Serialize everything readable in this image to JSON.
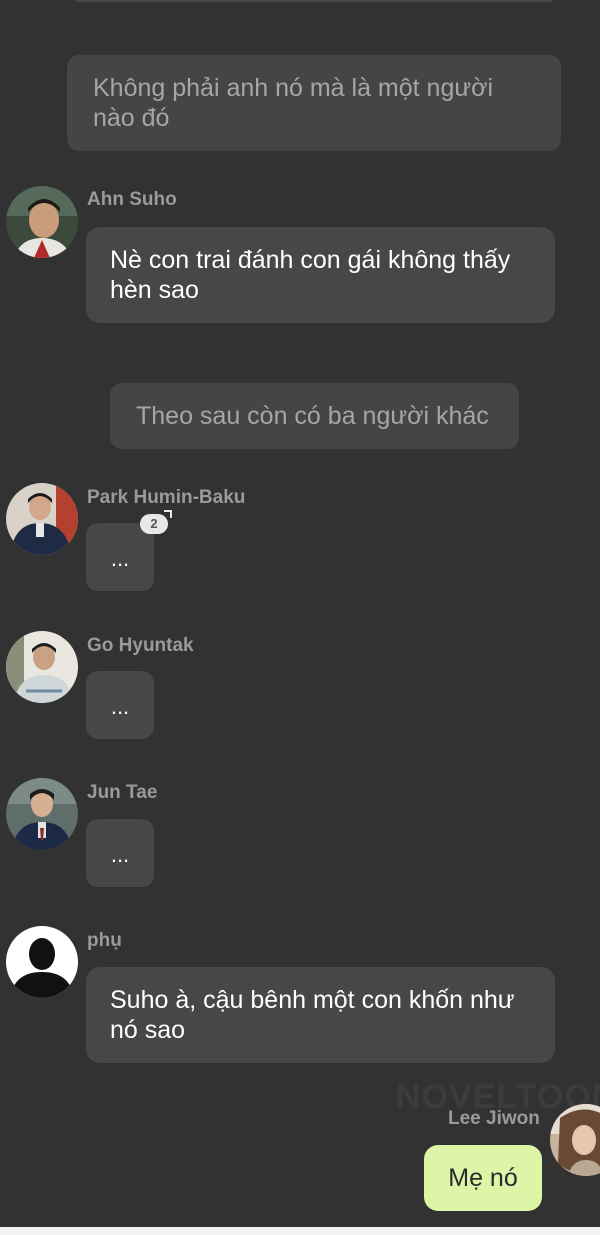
{
  "messages": {
    "narration_1": "Không phải anh nó mà là một người nào đó",
    "suho": {
      "name": "Ahn Suho",
      "text": "Nè con trai đánh con gái không thấy hèn sao"
    },
    "narration_2": "Theo sau còn có ba người khác",
    "baku": {
      "name": "Park Humin-Baku",
      "text": "...",
      "badge": "2"
    },
    "hyuntak": {
      "name": "Go Hyuntak",
      "text": "..."
    },
    "juntae": {
      "name": "Jun Tae",
      "text": "..."
    },
    "phu": {
      "name": "phụ",
      "text": "Suho à, cậu bênh một con khốn như nó sao"
    },
    "jiwon": {
      "name": "Lee Jiwon",
      "text": "Mẹ nó"
    }
  },
  "watermark": "NOVELTOON",
  "colors": {
    "background": "#323232",
    "bubble": "#474747",
    "narration_text": "#a6a6a6",
    "my_bubble": "#dcf5a6"
  },
  "icons": {
    "suho_avatar": "avatar-photo",
    "baku_avatar": "avatar-photo",
    "hyuntak_avatar": "avatar-photo",
    "juntae_avatar": "avatar-photo",
    "phu_avatar": "silhouette-avatar-icon",
    "jiwon_avatar": "avatar-photo"
  }
}
